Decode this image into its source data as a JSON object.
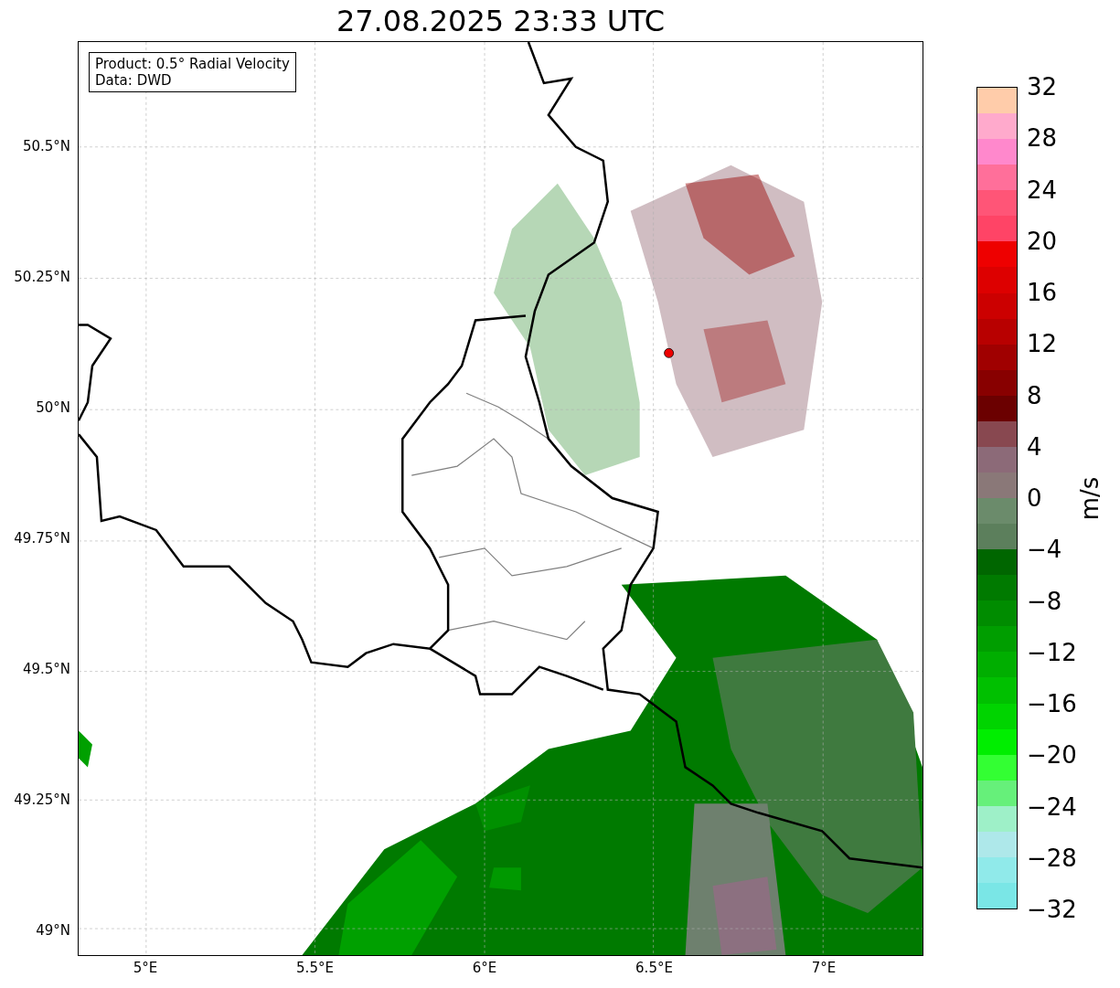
{
  "title": "27.08.2025 23:33 UTC",
  "map": {
    "legend": [
      "Product: 0.5° Radial Velocity",
      "Data: DWD"
    ],
    "lat_labels": [
      "50.5°N",
      "50.25°N",
      "50°N",
      "49.75°N",
      "49.5°N",
      "49.25°N",
      "49°N"
    ],
    "lon_labels": [
      "5°E",
      "5.5°E",
      "6°E",
      "6.5°E",
      "7°E"
    ]
  },
  "colorbar": {
    "label": "m/s",
    "ticks": [
      "32",
      "28",
      "24",
      "20",
      "16",
      "12",
      "8",
      "4",
      "0",
      "−4",
      "−8",
      "−12",
      "−16",
      "−20",
      "−24",
      "−28",
      "−32"
    ],
    "bands": [
      {
        "color": "#ffccaa"
      },
      {
        "color": "#ffaacc"
      },
      {
        "color": "#ff88cc"
      },
      {
        "color": "#ff6f9a"
      },
      {
        "color": "#ff5577"
      },
      {
        "color": "#ff4466"
      },
      {
        "color": "#ee0000"
      },
      {
        "color": "#dd0000"
      },
      {
        "color": "#cc0000"
      },
      {
        "color": "#b80000"
      },
      {
        "color": "#a00000"
      },
      {
        "color": "#880000"
      },
      {
        "color": "#6b0000"
      },
      {
        "color": "#884850"
      },
      {
        "color": "#8c6a78"
      },
      {
        "color": "#8a7878"
      },
      {
        "color": "#6b8b6b"
      },
      {
        "color": "#5c7f5c"
      },
      {
        "color": "#006600"
      },
      {
        "color": "#007a00"
      },
      {
        "color": "#008c00"
      },
      {
        "color": "#009e00"
      },
      {
        "color": "#00ae00"
      },
      {
        "color": "#00c000"
      },
      {
        "color": "#00d400"
      },
      {
        "color": "#00ee00"
      },
      {
        "color": "#33ff33"
      },
      {
        "color": "#66f07a"
      },
      {
        "color": "#9ef0c8"
      },
      {
        "color": "#aee8ea"
      },
      {
        "color": "#90eaea"
      },
      {
        "color": "#7ae6e6"
      }
    ]
  }
}
